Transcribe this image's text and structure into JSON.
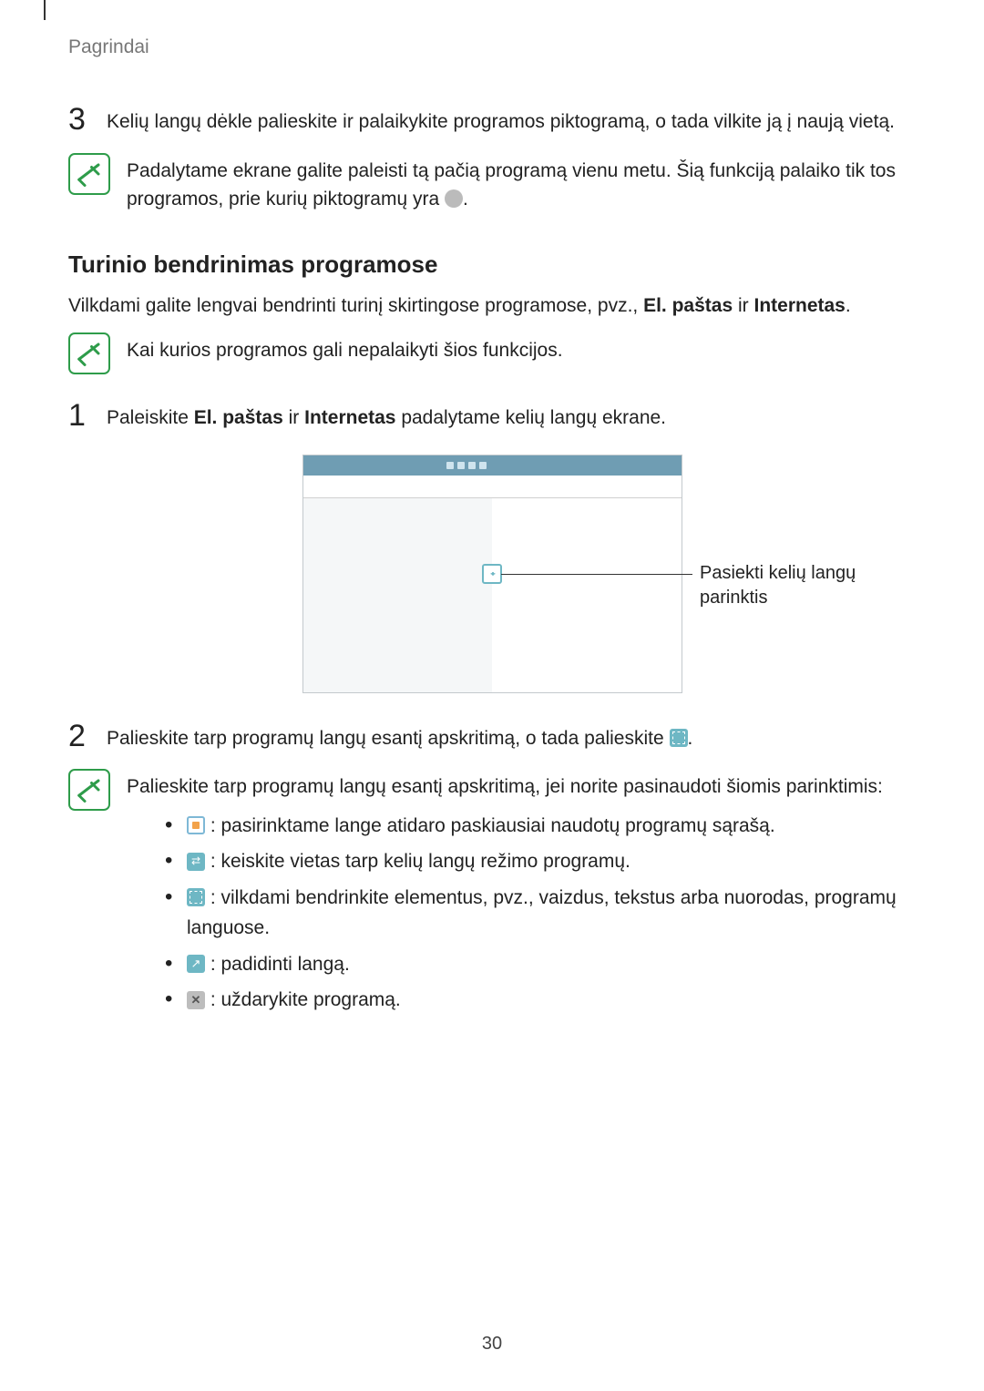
{
  "breadcrumb": "Pagrindai",
  "step3": {
    "num": "3",
    "text": "Kelių langų dėkle palieskite ir palaikykite programos piktogramą, o tada vilkite ją į naują vietą."
  },
  "note1": {
    "prefix": "Padalytame ekrane galite paleisti tą pačią programą vienu metu. Šią funkciją palaiko tik tos programos, prie kurių piktogramų yra ",
    "suffix": "."
  },
  "section_heading": "Turinio bendrinimas programose",
  "intro": {
    "prefix": "Vilkdami galite lengvai bendrinti turinį skirtingose programose, pvz., ",
    "b1": "El. paštas",
    "mid": " ir ",
    "b2": "Internetas",
    "suffix": "."
  },
  "note2": "Kai kurios programos gali nepalaikyti šios funkcijos.",
  "step1": {
    "num": "1",
    "prefix": "Paleiskite ",
    "b1": "El. paštas",
    "mid": " ir ",
    "b2": "Internetas",
    "suffix": " padalytame kelių langų ekrane."
  },
  "callout": "Pasiekti kelių langų parinktis",
  "step2": {
    "num": "2",
    "prefix": "Palieskite tarp programų langų esantį apskritimą, o tada palieskite ",
    "suffix": "."
  },
  "note3": "Palieskite tarp programų langų esantį apskritimą, jei norite pasinaudoti šiomis parinktimis:",
  "bullets": {
    "b1": " : pasirinktame lange atidaro paskiausiai naudotų programų sąrašą.",
    "b2": " : keiskite vietas tarp kelių langų režimo programų.",
    "b3": " : vilkdami bendrinkite elementus, pvz., vaizdus, tekstus arba nuorodas, programų languose.",
    "b4": " : padidinti langą.",
    "b5": " : uždarykite programą."
  },
  "page_number": "30"
}
